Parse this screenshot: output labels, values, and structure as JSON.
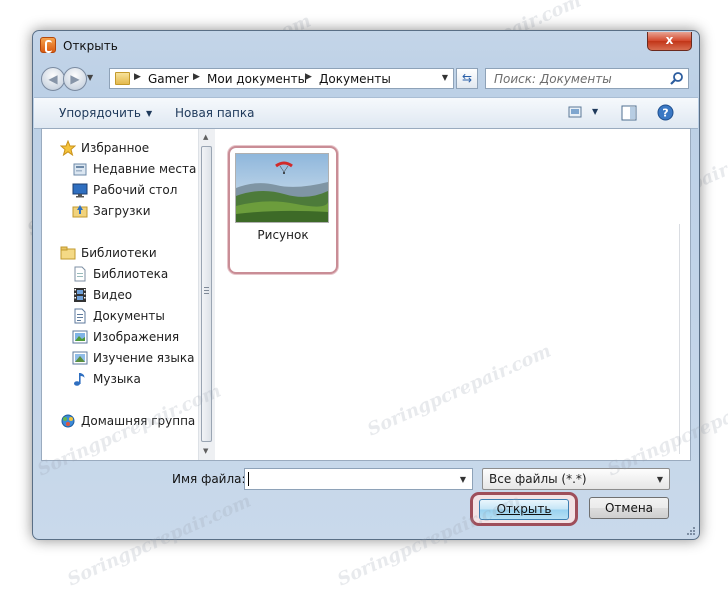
{
  "window": {
    "title": "Открыть",
    "close_label": "x"
  },
  "address": {
    "crumbs": [
      "Gamer",
      "Мои документы",
      "Документы"
    ]
  },
  "search": {
    "placeholder": "Поиск: Документы"
  },
  "toolbar": {
    "organize_label": "Упорядочить",
    "new_folder_label": "Новая папка"
  },
  "nav": {
    "favorites": {
      "label": "Избранное",
      "icon": "star-icon"
    },
    "favorites_items": [
      {
        "label": "Недавние места",
        "icon": "recent-places-icon"
      },
      {
        "label": "Рабочий стол",
        "icon": "desktop-icon"
      },
      {
        "label": "Загрузки",
        "icon": "downloads-icon"
      }
    ],
    "libraries": {
      "label": "Библиотеки",
      "icon": "libraries-icon"
    },
    "libraries_items": [
      {
        "label": "Библиотека",
        "icon": "library-icon"
      },
      {
        "label": "Видео",
        "icon": "video-icon"
      },
      {
        "label": "Документы",
        "icon": "documents-icon"
      },
      {
        "label": "Изображения",
        "icon": "pictures-icon"
      },
      {
        "label": "Изучение языка",
        "icon": "language-icon"
      },
      {
        "label": "Музыка",
        "icon": "music-icon"
      }
    ],
    "homegroup": {
      "label": "Домашняя группа",
      "icon": "homegroup-icon"
    }
  },
  "files": [
    {
      "name": "Рисунок",
      "icon": "image-thumbnail"
    }
  ],
  "bottom": {
    "filename_label": "Имя файла:",
    "filename_value": "",
    "filetype_value": "Все файлы (*.*)",
    "open_label": "Открыть",
    "cancel_label": "Отмена"
  },
  "watermark": "Soringpcrepair.com",
  "colors": {
    "highlight_border": "#9e4e5a",
    "window_frame": "#c4d5e8",
    "close_button": "#d3472b"
  }
}
